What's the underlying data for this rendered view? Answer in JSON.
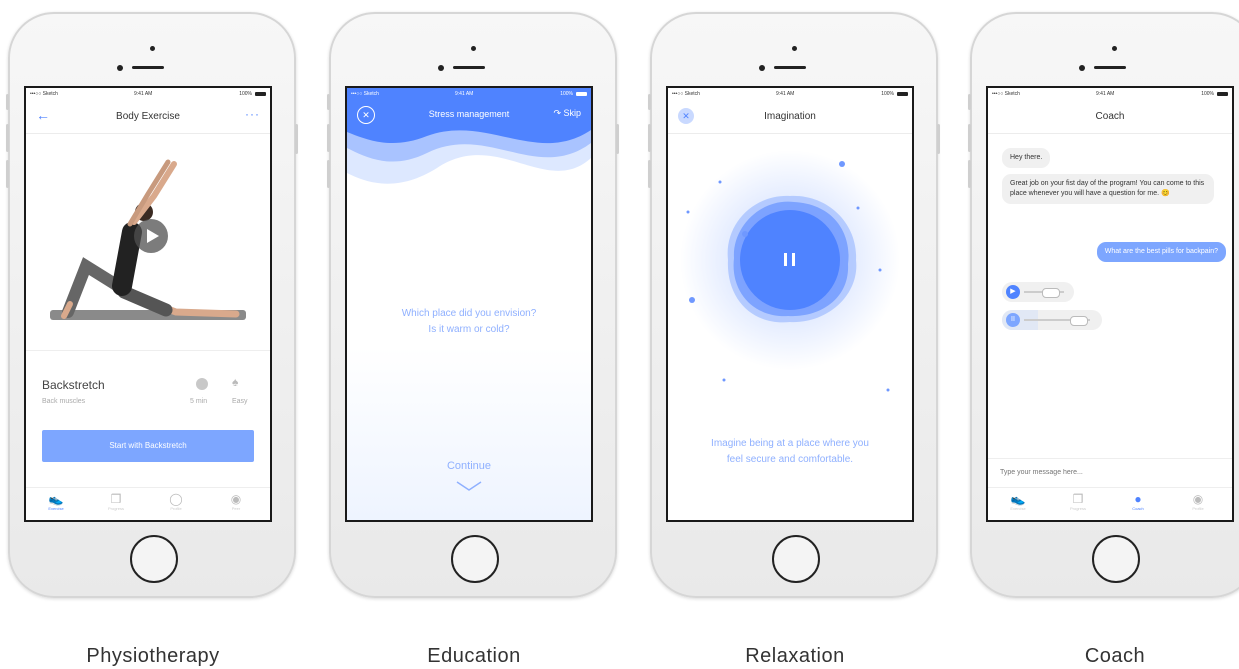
{
  "status": {
    "carrier": "•••○○ Sketch",
    "time": "9:41 AM",
    "battery": "100%"
  },
  "phones": [
    {
      "caption": "Physiotherapy",
      "title": "Body Exercise",
      "exercise": {
        "name": "Backstretch",
        "subtitle": "Back muscles",
        "duration": "5 min",
        "difficulty": "Easy"
      },
      "start_button": "Start with Backstretch",
      "tabs": [
        "Exercise",
        "Progress",
        "Profile",
        "Peer"
      ],
      "active_tab": 0
    },
    {
      "caption": "Education",
      "title": "Stress management",
      "skip": "Skip",
      "question_line1": "Which place did you envision?",
      "question_line2": "Is it warm or cold?",
      "continue": "Continue"
    },
    {
      "caption": "Relaxation",
      "title": "Imagination",
      "prompt_line1": "Imagine being at a place where you",
      "prompt_line2": "feel secure and comfortable.",
      "play_state": "paused"
    },
    {
      "caption": "Coach",
      "title": "Coach",
      "messages": [
        {
          "from": "coach",
          "text": "Hey there."
        },
        {
          "from": "coach",
          "text": "Great job on your fist day of the program! You can come to this place whenever you will have a question for me. 😊"
        },
        {
          "from": "user",
          "text": "What are the best pills for backpain?"
        }
      ],
      "input_placeholder": "Type your message here...",
      "tabs": [
        "Exercise",
        "Progress",
        "Coach",
        "Profile"
      ],
      "active_tab": 2
    }
  ],
  "colors": {
    "accent": "#4f83ff",
    "accent_light": "#7da6ff",
    "text": "#333333"
  }
}
